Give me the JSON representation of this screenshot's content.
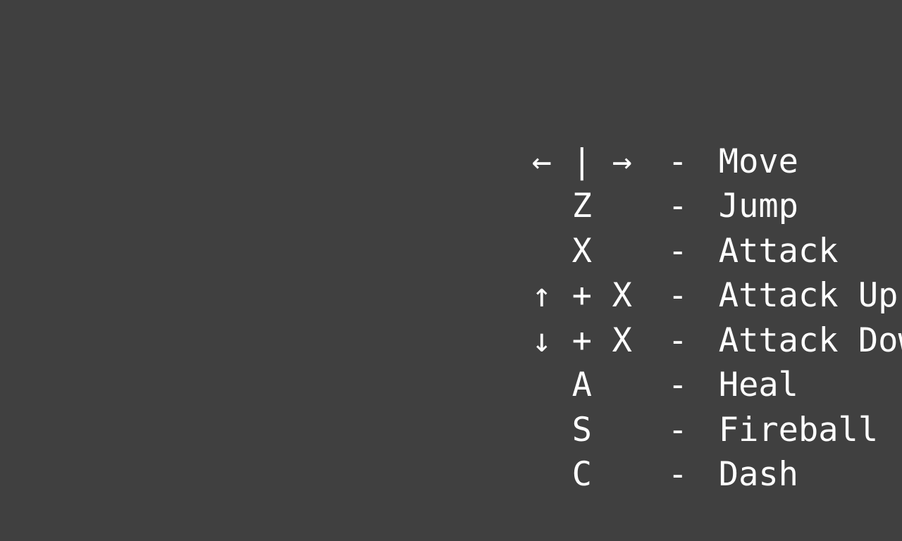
{
  "colors": {
    "background": "#404040",
    "text": "#ffffff"
  },
  "controls": [
    {
      "keys": [
        "←",
        "|",
        "→"
      ],
      "separator": "-",
      "action": "Move"
    },
    {
      "keys": [
        "",
        "Z",
        ""
      ],
      "separator": "-",
      "action": "Jump"
    },
    {
      "keys": [
        "",
        "X",
        ""
      ],
      "separator": "-",
      "action": "Attack"
    },
    {
      "keys": [
        "↑",
        "+",
        "X"
      ],
      "separator": "-",
      "action": "Attack Up"
    },
    {
      "keys": [
        "↓",
        "+",
        "X"
      ],
      "separator": "-",
      "action": "Attack Down"
    },
    {
      "keys": [
        "",
        "A",
        ""
      ],
      "separator": "-",
      "action": "Heal"
    },
    {
      "keys": [
        "",
        "S",
        ""
      ],
      "separator": "-",
      "action": "Fireball"
    },
    {
      "keys": [
        "",
        "C",
        ""
      ],
      "separator": "-",
      "action": "Dash"
    }
  ]
}
